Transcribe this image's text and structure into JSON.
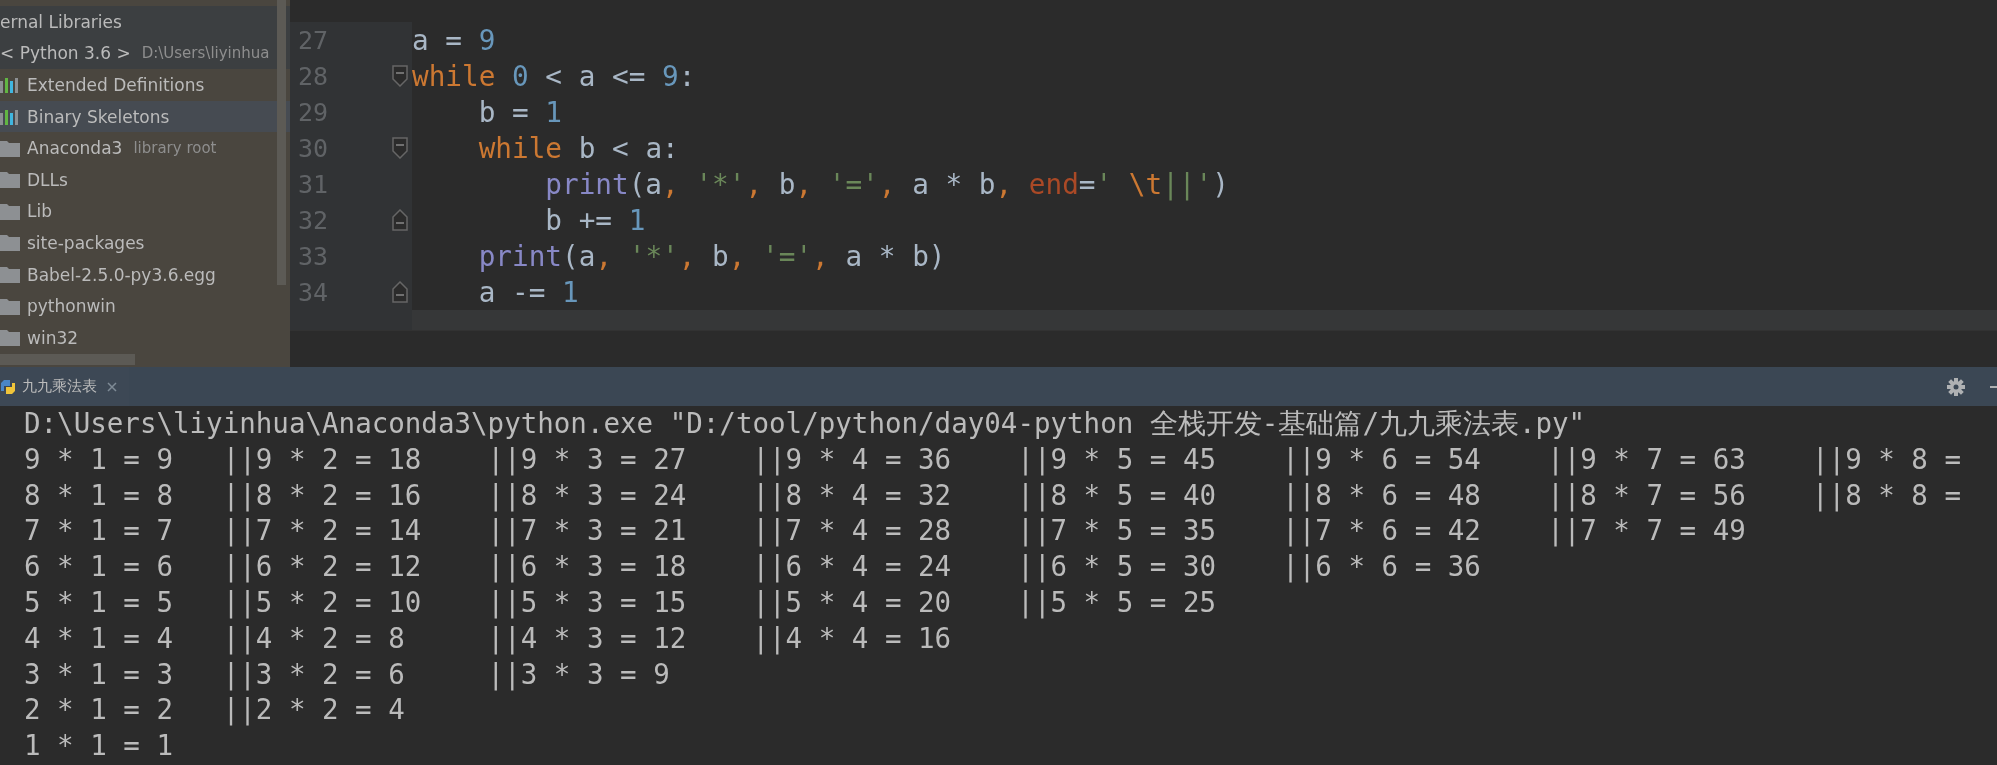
{
  "sidebar": {
    "items": [
      {
        "label": "ernal Libraries",
        "kind": "group",
        "selected": false
      },
      {
        "label": "< Python 3.6 >",
        "hint": "D:\\Users\\liyinhua",
        "kind": "group",
        "selected": false
      },
      {
        "label": "Extended Definitions",
        "kind": "library",
        "selected": false
      },
      {
        "label": "Binary Skeletons",
        "kind": "library",
        "selected": true
      },
      {
        "label": "Anaconda3",
        "hint": "library root",
        "kind": "folder",
        "selected": false
      },
      {
        "label": "DLLs",
        "kind": "folder",
        "selected": false
      },
      {
        "label": "Lib",
        "kind": "folder",
        "selected": false
      },
      {
        "label": "site-packages",
        "kind": "folder",
        "selected": false
      },
      {
        "label": "Babel-2.5.0-py3.6.egg",
        "kind": "folder",
        "selected": false
      },
      {
        "label": "pythonwin",
        "kind": "folder",
        "selected": false
      },
      {
        "label": "win32",
        "kind": "folder",
        "selected": false
      }
    ]
  },
  "editor": {
    "lines": [
      {
        "number": "27",
        "kind": "code",
        "current": false,
        "tokens": [
          {
            "t": "a = ",
            "kind": "plain"
          },
          {
            "t": "9",
            "kind": "num"
          }
        ]
      },
      {
        "number": "28",
        "kind": "fold-open",
        "current": false,
        "tokens": [
          {
            "t": "while ",
            "kind": "kw"
          },
          {
            "t": "0",
            "kind": "num"
          },
          {
            "t": " < a <= ",
            "kind": "plain"
          },
          {
            "t": "9",
            "kind": "num"
          },
          {
            "t": ":",
            "kind": "plain"
          }
        ],
        "children": [
          {
            "number": "29",
            "kind": "code",
            "current": false,
            "tokens": [
              {
                "t": "b = ",
                "kind": "plain"
              },
              {
                "t": "1",
                "kind": "num"
              }
            ]
          },
          {
            "number": "30",
            "kind": "fold-open",
            "current": false,
            "tokens": [
              {
                "t": "while",
                "kind": "kw"
              },
              {
                "t": " b < a:",
                "kind": "plain"
              }
            ],
            "children": [
              {
                "number": "31",
                "kind": "code",
                "current": false,
                "tokens": [
                  {
                    "t": "print",
                    "kind": "fn"
                  },
                  {
                    "t": "(a",
                    "kind": "plain"
                  },
                  {
                    "t": ", ",
                    "kind": "punct"
                  },
                  {
                    "t": "'*'",
                    "kind": "str"
                  },
                  {
                    "t": ", ",
                    "kind": "punct"
                  },
                  {
                    "t": "b",
                    "kind": "plain"
                  },
                  {
                    "t": ", ",
                    "kind": "punct"
                  },
                  {
                    "t": "'='",
                    "kind": "str"
                  },
                  {
                    "t": ", ",
                    "kind": "punct"
                  },
                  {
                    "t": "a * b",
                    "kind": "plain"
                  },
                  {
                    "t": ", ",
                    "kind": "punct"
                  },
                  {
                    "t": "end",
                    "kind": "kwarg"
                  },
                  {
                    "t": "=",
                    "kind": "plain"
                  },
                  {
                    "t": "' ",
                    "kind": "str"
                  },
                  {
                    "t": "\\t",
                    "kind": "esc"
                  },
                  {
                    "t": "||'",
                    "kind": "str"
                  },
                  {
                    "t": ")",
                    "kind": "plain"
                  }
                ]
              },
              {
                "number": "32",
                "kind": "fold-close",
                "current": false,
                "tokens": [
                  {
                    "t": "b += ",
                    "kind": "plain"
                  },
                  {
                    "t": "1",
                    "kind": "num"
                  }
                ]
              }
            ]
          },
          {
            "number": "33",
            "kind": "code",
            "current": false,
            "tokens": [
              {
                "t": "print",
                "kind": "fn"
              },
              {
                "t": "(a",
                "kind": "plain"
              },
              {
                "t": ", ",
                "kind": "punct"
              },
              {
                "t": "'*'",
                "kind": "str"
              },
              {
                "t": ", ",
                "kind": "punct"
              },
              {
                "t": "b",
                "kind": "plain"
              },
              {
                "t": ", ",
                "kind": "punct"
              },
              {
                "t": "'='",
                "kind": "str"
              },
              {
                "t": ", ",
                "kind": "punct"
              },
              {
                "t": "a * b)",
                "kind": "plain"
              }
            ]
          },
          {
            "number": "34",
            "kind": "fold-close",
            "current": false,
            "tokens": [
              {
                "t": "a -= ",
                "kind": "plain"
              },
              {
                "t": "1",
                "kind": "num"
              }
            ]
          }
        ]
      },
      {
        "kind": "code",
        "current": true
      }
    ]
  },
  "console": {
    "tab": {
      "label": "九九乘法表"
    },
    "command": "D:\\Users\\liyinhua\\Anaconda3\\python.exe \"D:/tool/python/day04-python 全栈开发-基础篇/九九乘法表.py\"",
    "rows": [
      [
        "9 * 1 = 9",
        "||9 * 2 = 18",
        "||9 * 3 = 27",
        "||9 * 4 = 36",
        "||9 * 5 = 45",
        "||9 * 6 = 54",
        "||9 * 7 = 63",
        "||9 * 8 ="
      ],
      [
        "8 * 1 = 8",
        "||8 * 2 = 16",
        "||8 * 3 = 24",
        "||8 * 4 = 32",
        "||8 * 5 = 40",
        "||8 * 6 = 48",
        "||8 * 7 = 56",
        "||8 * 8 ="
      ],
      [
        "7 * 1 = 7",
        "||7 * 2 = 14",
        "||7 * 3 = 21",
        "||7 * 4 = 28",
        "||7 * 5 = 35",
        "||7 * 6 = 42",
        "||7 * 7 = 49"
      ],
      [
        "6 * 1 = 6",
        "||6 * 2 = 12",
        "||6 * 3 = 18",
        "||6 * 4 = 24",
        "||6 * 5 = 30",
        "||6 * 6 = 36"
      ],
      [
        "5 * 1 = 5",
        "||5 * 2 = 10",
        "||5 * 3 = 15",
        "||5 * 4 = 20",
        "||5 * 5 = 25"
      ],
      [
        "4 * 1 = 4",
        "||4 * 2 = 8",
        "||4 * 3 = 12",
        "||4 * 4 = 16"
      ],
      [
        "3 * 1 = 3",
        "||3 * 2 = 6",
        "||3 * 3 = 9"
      ],
      [
        "2 * 1 = 2",
        "||2 * 2 = 4"
      ],
      [
        "1 * 1 = 1"
      ]
    ]
  }
}
